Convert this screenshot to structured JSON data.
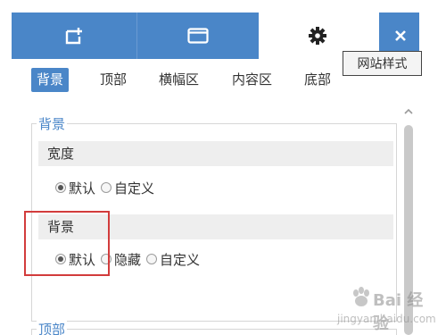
{
  "toolbar": {
    "add_icon": "add-page-icon",
    "window_icon": "window-icon",
    "settings_icon": "gear-icon",
    "close_icon": "close-icon",
    "accent_color": "#4a86c8"
  },
  "tabs": [
    {
      "label": "背景",
      "active": true
    },
    {
      "label": "顶部",
      "active": false
    },
    {
      "label": "横幅区",
      "active": false
    },
    {
      "label": "内容区",
      "active": false
    },
    {
      "label": "底部",
      "active": false
    }
  ],
  "tooltip": "网站样式",
  "section_background": {
    "legend": "背景",
    "width_row": {
      "label": "宽度",
      "options": [
        "默认",
        "自定义"
      ],
      "selected": "默认"
    },
    "bg_row": {
      "label": "背景",
      "options": [
        "默认",
        "隐藏",
        "自定义"
      ],
      "selected": "默认"
    }
  },
  "section_top": {
    "legend": "顶部"
  },
  "watermark": {
    "text": "Bai 经验",
    "url": "jingyan.baidu.com"
  }
}
